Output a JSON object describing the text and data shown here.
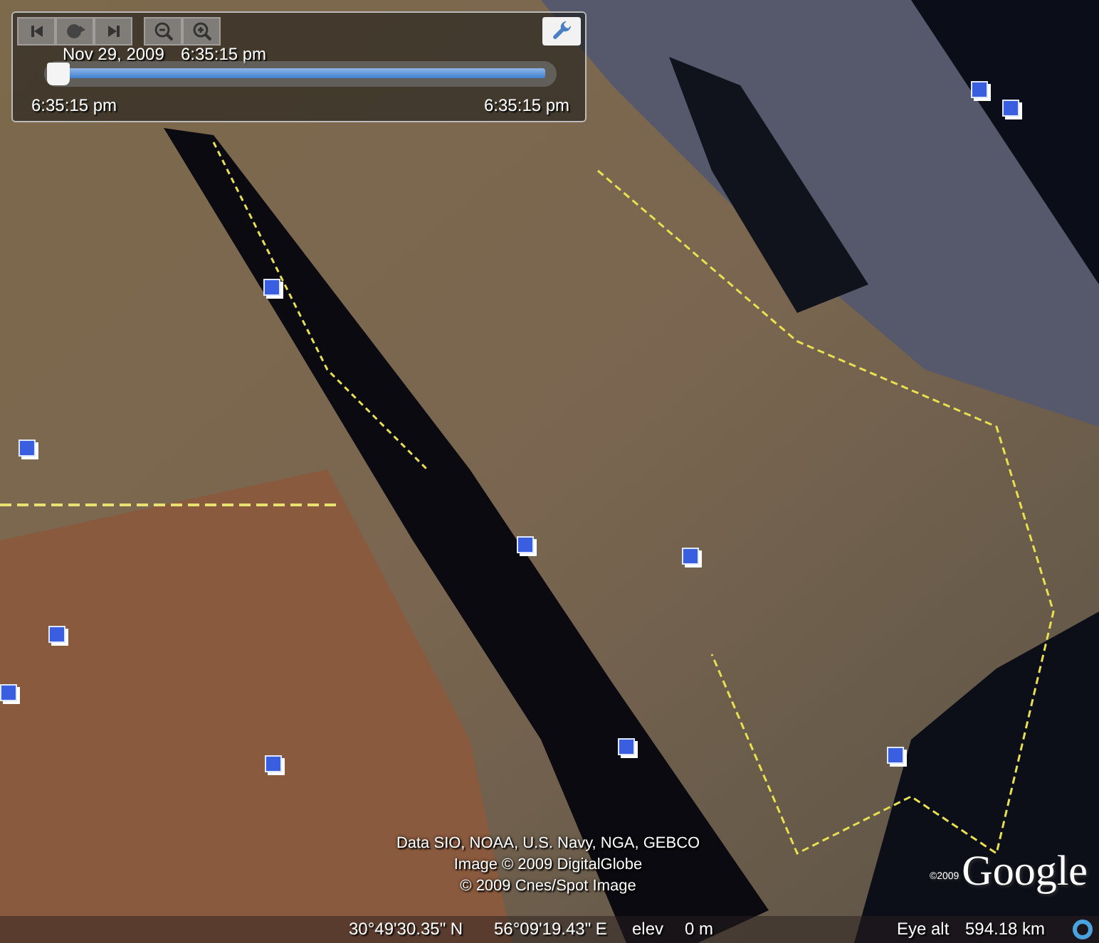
{
  "time_slider": {
    "date": "Nov 29, 2009",
    "time": "6:35:15 pm",
    "slider": {
      "level": 0
    },
    "start_time": "6:35:15 pm",
    "end_time": "6:35:15 pm"
  },
  "attribution": [
    "Data SIO, NOAA, U.S. Navy, NGA, GEBCO",
    "Image © 2009 DigitalGlobe",
    "© 2009 Cnes/Spot Image"
  ],
  "logo": {
    "copyright": "©2009",
    "name": "Google"
  },
  "status_bar": {
    "latitude": "30°49'30.35\" N",
    "longitude": "56°09'19.43\" E",
    "elev_label": "elev",
    "elev_value": "0 m",
    "eye_alt_label": "Eye alt",
    "eye_alt_value": "594.18 km"
  }
}
